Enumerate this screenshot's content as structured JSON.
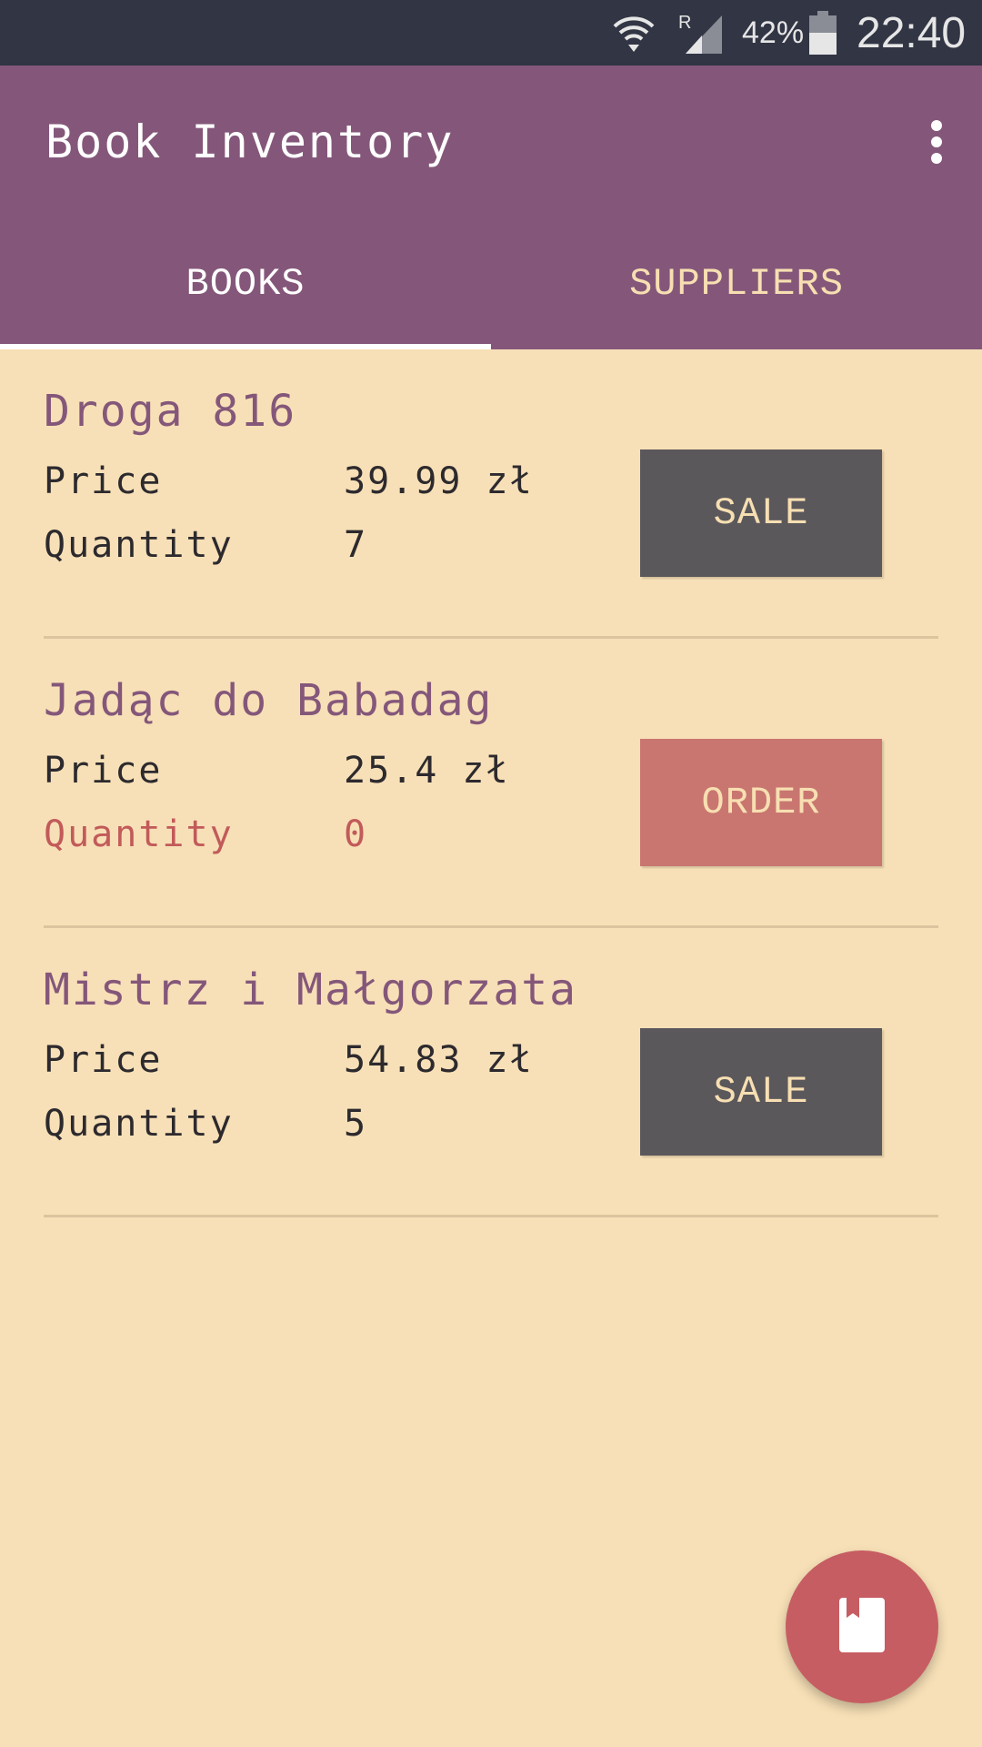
{
  "status_bar": {
    "battery_percent": "42%",
    "time": "22:40",
    "icons": [
      "wifi-icon",
      "signal-icon",
      "battery-icon"
    ]
  },
  "app_bar": {
    "title": "Book Inventory",
    "menu_icon": "overflow-menu-icon"
  },
  "tabs": [
    {
      "label": "BOOKS",
      "selected": true
    },
    {
      "label": "SUPPLIERS",
      "selected": false
    }
  ],
  "books": [
    {
      "title": "Droga 816",
      "price_label": "Price",
      "price": "39.99 zł",
      "quantity_label": "Quantity",
      "quantity": "7",
      "action": "SALE"
    },
    {
      "title": "Jadąc do Babadag",
      "price_label": "Price",
      "price": "25.4 zł",
      "quantity_label": "Quantity",
      "quantity": "0",
      "action": "ORDER"
    },
    {
      "title": "Mistrz i Małgorzata",
      "price_label": "Price",
      "price": "54.83 zł",
      "quantity_label": "Quantity",
      "quantity": "5",
      "action": "SALE"
    }
  ],
  "fab": {
    "icon": "book-icon"
  },
  "colors": {
    "primary": "#84577a",
    "background": "#f7e0b7",
    "sale_button": "#5b585c",
    "order_button": "#c97670",
    "fab": "#c65d62",
    "out_of_stock_text": "#c25a5a"
  }
}
